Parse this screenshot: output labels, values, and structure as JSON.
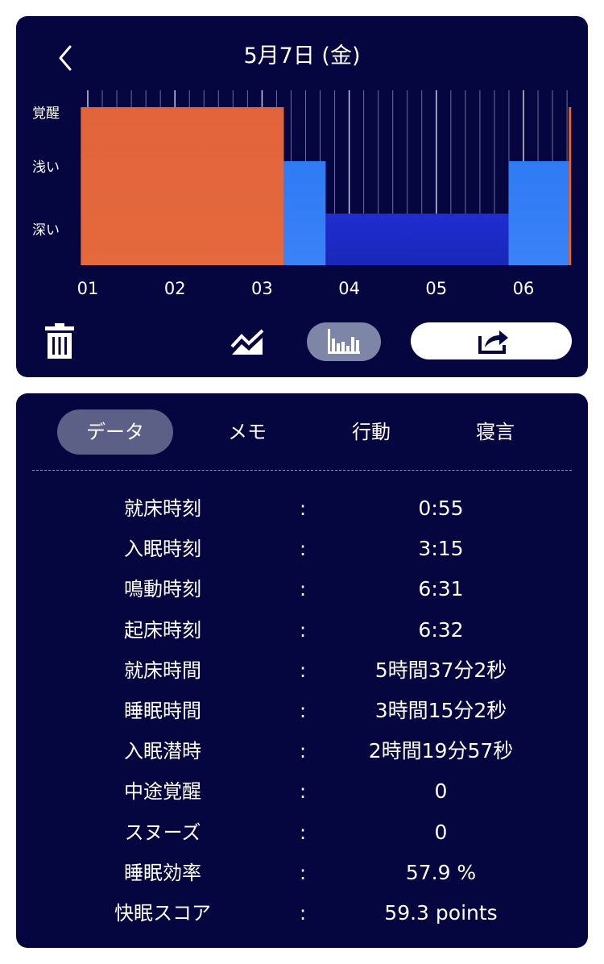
{
  "header": {
    "title": "5月7日 (金)"
  },
  "chart_data": {
    "type": "area",
    "title": "",
    "y_levels": [
      "覚醒",
      "浅い",
      "深い"
    ],
    "x_ticks": [
      "01",
      "02",
      "03",
      "04",
      "05",
      "06"
    ],
    "x_range_hours": [
      0.92,
      6.53
    ],
    "segments": [
      {
        "stage": "覚醒",
        "start_hour": 0.92,
        "end_hour": 3.25
      },
      {
        "stage": "浅い",
        "start_hour": 3.25,
        "end_hour": 3.73
      },
      {
        "stage": "深い",
        "start_hour": 3.73,
        "end_hour": 5.83
      },
      {
        "stage": "浅い",
        "start_hour": 5.83,
        "end_hour": 6.52
      },
      {
        "stage": "覚醒",
        "start_hour": 6.52,
        "end_hour": 6.53
      }
    ],
    "colors": {
      "覚醒": "#e2643b",
      "浅い": "#2f7bf4",
      "深い": "#1f2ed0"
    }
  },
  "toolbar": {
    "delete_icon": "trash-icon",
    "line_icon": "line-chart-icon",
    "bar_icon": "bar-chart-icon",
    "share_icon": "share-icon"
  },
  "tabs": [
    "データ",
    "メモ",
    "行動",
    "寝言"
  ],
  "rows": [
    {
      "label": "就床時刻",
      "colon": ":",
      "value": "0:55"
    },
    {
      "label": "入眠時刻",
      "colon": ":",
      "value": "3:15"
    },
    {
      "label": "鳴動時刻",
      "colon": ":",
      "value": "6:31"
    },
    {
      "label": "起床時刻",
      "colon": ":",
      "value": "6:32"
    },
    {
      "label": "就床時間",
      "colon": ":",
      "value": "5時間37分2秒"
    },
    {
      "label": "睡眠時間",
      "colon": ":",
      "value": "3時間15分2秒"
    },
    {
      "label": "入眠潜時",
      "colon": ":",
      "value": "2時間19分57秒"
    },
    {
      "label": "中途覚醒",
      "colon": ":",
      "value": "0"
    },
    {
      "label": "スヌーズ",
      "colon": ":",
      "value": "0"
    },
    {
      "label": "睡眠効率",
      "colon": ":",
      "value": "57.9 %"
    },
    {
      "label": "快眠スコア",
      "colon": ":",
      "value": "59.3 points"
    }
  ]
}
